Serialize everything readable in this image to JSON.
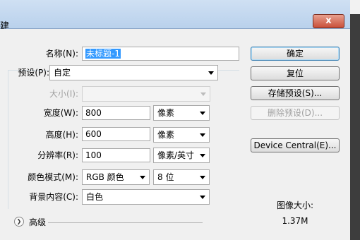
{
  "window": {
    "title": "建",
    "close_label": "x"
  },
  "form": {
    "name_label": "名称(N):",
    "name_value": "未标题-1",
    "preset_label": "预设(P):",
    "preset_value": "自定",
    "size_label": "大小(I):",
    "size_value": "",
    "width_label": "宽度(W):",
    "width_value": "800",
    "width_unit": "像素",
    "height_label": "高度(H):",
    "height_value": "600",
    "height_unit": "像素",
    "resolution_label": "分辨率(R):",
    "resolution_value": "100",
    "resolution_unit": "像素/英寸",
    "color_mode_label": "颜色模式(M):",
    "color_mode_value": "RGB 颜色",
    "bit_depth_value": "8 位",
    "background_label": "背景内容(C):",
    "background_value": "白色",
    "advanced_label": "高级"
  },
  "buttons": {
    "ok": "确定",
    "reset": "复位",
    "save_preset": "存储预设(S)...",
    "delete_preset": "删除预设(D)...",
    "device_central": "Device Central(E)..."
  },
  "info": {
    "image_size_label": "图像大小:",
    "image_size_value": "1.37M"
  }
}
